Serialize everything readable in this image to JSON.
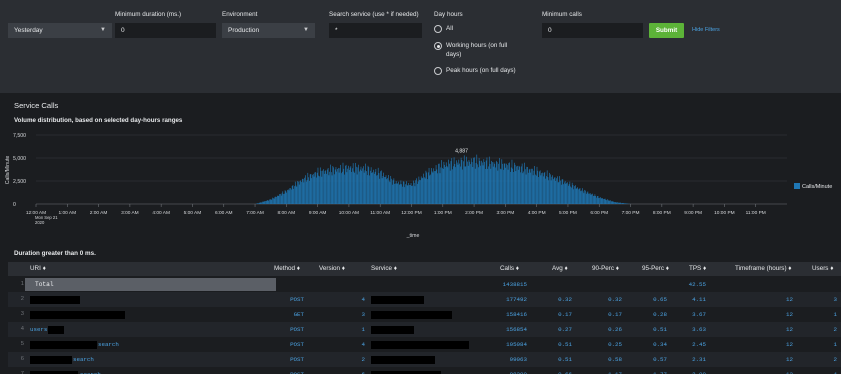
{
  "filters": {
    "time_range": {
      "value": "Yesterday"
    },
    "min_duration": {
      "label": "Minimum duration (ms.)",
      "value": "0"
    },
    "environment": {
      "label": "Environment",
      "value": "Production"
    },
    "search_service": {
      "label": "Search service (use * if needed)",
      "value": "*"
    },
    "day_hours": {
      "label": "Day hours",
      "options": [
        {
          "line1": "All",
          "line2": "",
          "selected": false
        },
        {
          "line1": "Working hours (on full",
          "line2": "days)",
          "selected": true
        },
        {
          "line1": "Peak hours (on full days)",
          "line2": "",
          "selected": false
        }
      ]
    },
    "min_calls": {
      "label": "Minimum calls",
      "value": "0"
    },
    "submit_label": "Submit",
    "hide_filters_label": "Hide Filters"
  },
  "panel": {
    "title": "Service Calls",
    "chart_title": "Volume distribution, based on selected day-hours ranges"
  },
  "colors": {
    "bar": "#1f77b4",
    "accent": "#4ba3e3",
    "submit": "#5cb338",
    "background": "#1b1d20",
    "panel": "#2b2e33"
  },
  "chart_data": {
    "type": "bar",
    "title": "Volume distribution, based on selected day-hours ranges",
    "xlabel": "_time",
    "ylabel": "Calls/Minute",
    "ylim": [
      0,
      7500
    ],
    "yticks": [
      "7,500",
      "5,000",
      "2,500",
      "0"
    ],
    "xticks": [
      "12:00 AM",
      "1:00 AM",
      "2:00 AM",
      "3:00 AM",
      "4:00 AM",
      "5:00 AM",
      "6:00 AM",
      "7:00 AM",
      "8:00 AM",
      "9:00 AM",
      "10:00 AM",
      "11:00 AM",
      "12:00 PM",
      "1:00 PM",
      "2:00 PM",
      "3:00 PM",
      "4:00 PM",
      "5:00 PM",
      "6:00 PM",
      "7:00 PM",
      "8:00 PM",
      "9:00 PM",
      "10:00 PM",
      "11:00 PM"
    ],
    "xtick_sub": [
      "Mon Sep 21",
      "2020"
    ],
    "peak_label": "4,887",
    "legend": [
      "Calls/Minute"
    ],
    "legend_position": "right",
    "series": [
      {
        "name": "Calls/Minute",
        "hour": [
          7.0,
          7.5,
          8.0,
          8.5,
          9.0,
          9.5,
          10.0,
          10.5,
          11.0,
          11.5,
          12.0,
          12.5,
          13.0,
          13.5,
          14.0,
          14.5,
          15.0,
          15.5,
          16.0,
          16.5,
          17.0,
          17.5,
          18.0,
          18.5,
          19.0
        ],
        "values": [
          0,
          500,
          1400,
          2600,
          3400,
          3700,
          3900,
          3800,
          3300,
          2300,
          2100,
          3300,
          4200,
          4500,
          4600,
          4400,
          4200,
          3900,
          3500,
          2900,
          2200,
          1400,
          700,
          200,
          0
        ]
      }
    ]
  },
  "table": {
    "title": "Duration greater than 0 ms.",
    "columns": [
      "URI ♦",
      "Method ♦",
      "Version ♦",
      "Service ♦",
      "Calls ♦",
      "Avg ♦",
      "90-Perc ♦",
      "95-Perc ♦",
      "TPS ♦",
      "Timeframe (hours) ♦",
      "Users ♦"
    ],
    "total": {
      "index": "1",
      "label": "Total",
      "calls": "1438815",
      "tps": "42.55"
    },
    "rows": [
      {
        "index": "2",
        "uri": "",
        "method": "POST",
        "version": "4",
        "calls": "177492",
        "avg": "0.32",
        "p90": "0.32",
        "p95": "0.65",
        "tps": "4.11",
        "timeframe": "12",
        "users": "3"
      },
      {
        "index": "3",
        "uri": "",
        "method": "GET",
        "version": "3",
        "calls": "158416",
        "avg": "0.17",
        "p90": "0.17",
        "p95": "0.28",
        "tps": "3.67",
        "timeframe": "12",
        "users": "1"
      },
      {
        "index": "4",
        "uri": "users",
        "method": "POST",
        "version": "1",
        "calls": "156854",
        "avg": "0.27",
        "p90": "0.26",
        "p95": "0.51",
        "tps": "3.63",
        "timeframe": "12",
        "users": "2"
      },
      {
        "index": "5",
        "uri": "search",
        "method": "POST",
        "version": "4",
        "calls": "105084",
        "avg": "0.51",
        "p90": "0.25",
        "p95": "0.34",
        "tps": "2.45",
        "timeframe": "12",
        "users": "1"
      },
      {
        "index": "6",
        "uri": "search",
        "method": "POST",
        "version": "2",
        "calls": "99063",
        "avg": "0.51",
        "p90": "0.58",
        "p95": "0.57",
        "tps": "2.31",
        "timeframe": "12",
        "users": "2"
      },
      {
        "index": "7",
        "uri": "search",
        "method": "POST",
        "version": "6",
        "calls": "98200",
        "avg": "0.66",
        "p90": "1.17",
        "p95": "1.77",
        "tps": "2.09",
        "timeframe": "12",
        "users": "4"
      }
    ]
  }
}
